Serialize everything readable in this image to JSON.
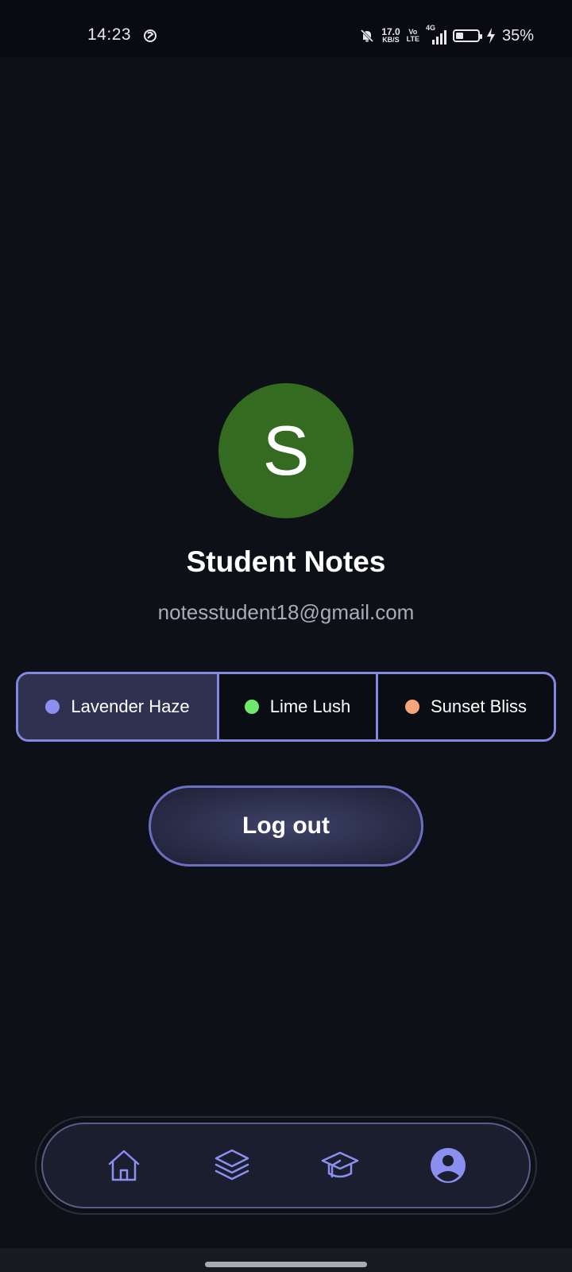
{
  "status_bar": {
    "time": "14:23",
    "net_speed_value": "17.0",
    "net_speed_unit": "KB/S",
    "volte_top": "Vo",
    "volte_bottom": "LTE",
    "network": "4G",
    "battery_level": 0.35,
    "battery_percent": "35%",
    "icons": [
      "sync-app-icon",
      "bell-muted-icon",
      "signal-icon",
      "battery-icon",
      "charging-bolt-icon"
    ]
  },
  "profile": {
    "avatar_letter": "S",
    "avatar_color": "#346b20",
    "name": "Student Notes",
    "email": "notesstudent18@gmail.com"
  },
  "themes": {
    "selected": "Lavender Haze",
    "options": [
      {
        "label": "Lavender Haze",
        "color": "#8b8ff0"
      },
      {
        "label": "Lime Lush",
        "color": "#6ee96e"
      },
      {
        "label": "Sunset Bliss",
        "color": "#f5a47c"
      }
    ]
  },
  "actions": {
    "logout_label": "Log out"
  },
  "bottom_nav": {
    "active": "profile",
    "items": [
      {
        "id": "home",
        "icon": "home-icon"
      },
      {
        "id": "stack",
        "icon": "layers-icon"
      },
      {
        "id": "courses",
        "icon": "graduation-cap-icon"
      },
      {
        "id": "profile",
        "icon": "user-circle-icon"
      }
    ],
    "accent_color": "#8b8ff0"
  }
}
